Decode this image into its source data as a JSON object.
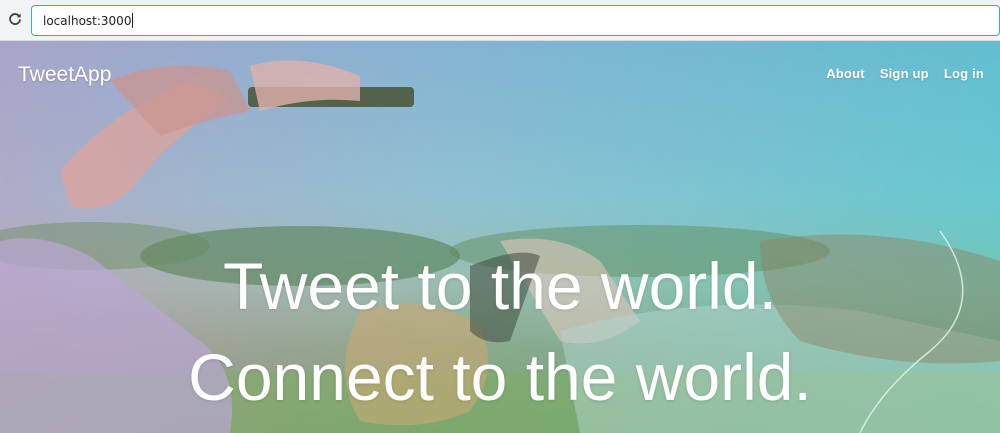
{
  "browser": {
    "url": "localhost:3000"
  },
  "site": {
    "logo": "TweetApp",
    "nav": [
      {
        "label": "About"
      },
      {
        "label": "Sign up"
      },
      {
        "label": "Log in"
      }
    ]
  },
  "hero": {
    "line1": "Tweet to the world.",
    "line2": "Connect to the world."
  }
}
